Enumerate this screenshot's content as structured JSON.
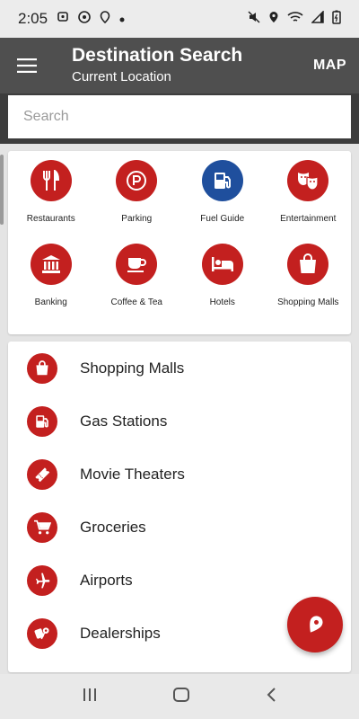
{
  "status_bar": {
    "time": "2:05"
  },
  "app_bar": {
    "title": "Destination Search",
    "subtitle": "Current Location",
    "map_label": "MAP"
  },
  "search": {
    "placeholder": "Search",
    "value": ""
  },
  "categories": [
    {
      "label": "Restaurants",
      "icon": "fork-knife-icon"
    },
    {
      "label": "Parking",
      "icon": "parking-icon"
    },
    {
      "label": "Fuel Guide",
      "icon": "fuel-pump-icon"
    },
    {
      "label": "Entertainment",
      "icon": "theater-masks-icon"
    },
    {
      "label": "Banking",
      "icon": "bank-icon"
    },
    {
      "label": "Coffee & Tea",
      "icon": "coffee-cup-icon"
    },
    {
      "label": "Hotels",
      "icon": "bed-icon"
    },
    {
      "label": "Shopping Malls",
      "icon": "shopping-bag-icon"
    }
  ],
  "list": [
    {
      "label": "Shopping Malls",
      "icon": "shopping-bag-icon"
    },
    {
      "label": "Gas Stations",
      "icon": "gas-station-icon"
    },
    {
      "label": "Movie Theaters",
      "icon": "ticket-icon"
    },
    {
      "label": "Groceries",
      "icon": "cart-icon"
    },
    {
      "label": "Airports",
      "icon": "airplane-icon"
    },
    {
      "label": "Dealerships",
      "icon": "car-keys-icon"
    }
  ],
  "colors": {
    "accent": "#c3201f",
    "fuel_blue": "#1f4f9d",
    "app_bar": "#4f4f4f"
  }
}
